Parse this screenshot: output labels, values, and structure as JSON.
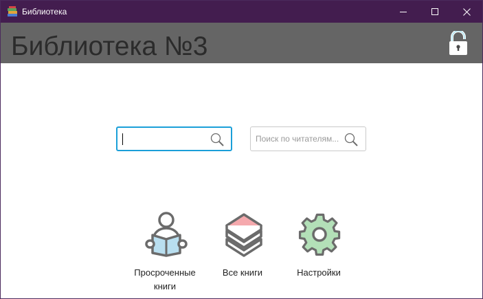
{
  "window": {
    "title": "Библиотека",
    "app_icon": "books-stack-icon"
  },
  "header": {
    "title": "Библиотека №3",
    "lock_icon": "unlocked-padlock-icon"
  },
  "search": {
    "books": {
      "value": "",
      "placeholder": "",
      "icon": "search-icon"
    },
    "readers": {
      "value": "",
      "placeholder": "Поиск по читателям...",
      "icon": "search-icon"
    }
  },
  "tiles": [
    {
      "label": "Просроченные\nкниги",
      "icon": "reader-with-book-icon"
    },
    {
      "label": "Все книги",
      "icon": "book-stack-icon"
    },
    {
      "label": "Настройки",
      "icon": "gear-icon"
    }
  ],
  "colors": {
    "titlebar": "#431d4f",
    "header": "#656565",
    "focus_border": "#1a9fd8",
    "book_blue": "#b9dff0",
    "book_pink": "#f5a9ad",
    "gear_green": "#b3e0b8",
    "icon_stroke": "#6b6b6b"
  }
}
